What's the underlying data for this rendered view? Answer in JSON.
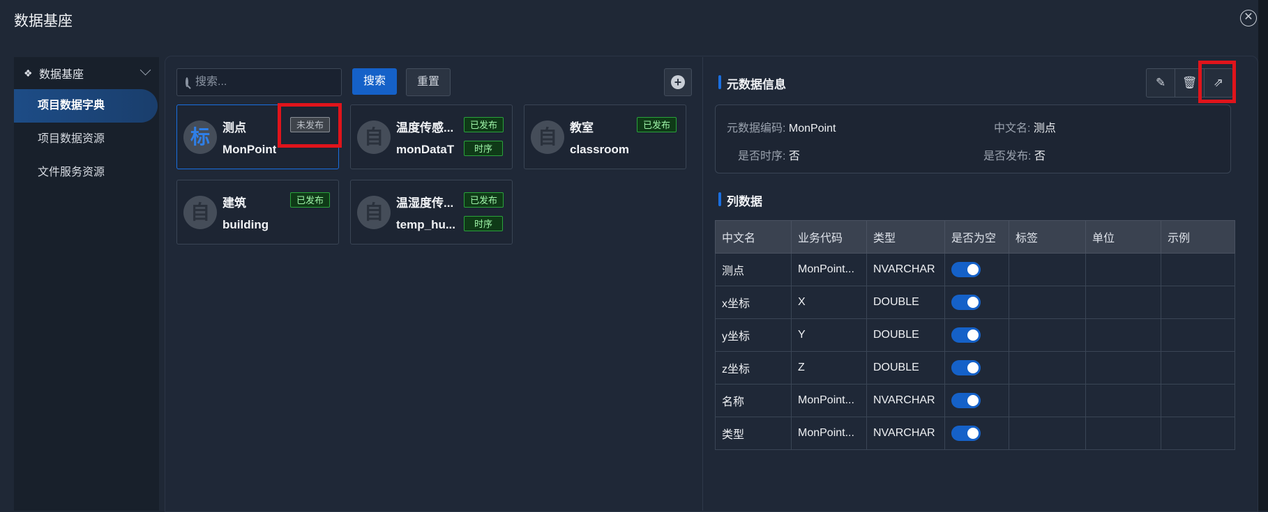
{
  "window": {
    "title": "数据基座"
  },
  "sidebar": {
    "header": "数据基座",
    "items": [
      {
        "label": "项目数据字典",
        "active": true
      },
      {
        "label": "项目数据资源"
      },
      {
        "label": "文件服务资源"
      }
    ]
  },
  "toolbar": {
    "search_placeholder": "搜索...",
    "search_label": "搜索",
    "reset_label": "重置"
  },
  "cards": [
    {
      "avatar": "标",
      "cn": "测点",
      "en": "MonPoint",
      "status": "未发布",
      "selected": true
    },
    {
      "avatar": "自",
      "cn": "温度传感...",
      "en": "monDataT",
      "status": "已发布",
      "extra": "时序"
    },
    {
      "avatar": "自",
      "cn": "教室",
      "en": "classroom",
      "status": "已发布"
    },
    {
      "avatar": "自",
      "cn": "建筑",
      "en": "building",
      "status": "已发布"
    },
    {
      "avatar": "自",
      "cn": "温湿度传...",
      "en": "temp_hu...",
      "status": "已发布",
      "extra": "时序"
    }
  ],
  "detail": {
    "meta_title": "元数据信息",
    "meta": {
      "code_label": "元数据编码:",
      "code_value": "MonPoint",
      "cname_label": "中文名:",
      "cname_value": "测点",
      "ts_label": "是否时序:",
      "ts_value": "否",
      "pub_label": "是否发布:",
      "pub_value": "否"
    },
    "cols_title": "列数据",
    "columns": [
      "中文名",
      "业务代码",
      "类型",
      "是否为空",
      "标签",
      "单位",
      "示例"
    ],
    "rows": [
      {
        "cn": "测点",
        "code": "MonPoint...",
        "type": "NVARCHAR",
        "nullable": true
      },
      {
        "cn": "x坐标",
        "code": "X",
        "type": "DOUBLE",
        "nullable": true
      },
      {
        "cn": "y坐标",
        "code": "Y",
        "type": "DOUBLE",
        "nullable": true
      },
      {
        "cn": "z坐标",
        "code": "Z",
        "type": "DOUBLE",
        "nullable": true
      },
      {
        "cn": "名称",
        "code": "MonPoint...",
        "type": "NVARCHAR",
        "nullable": true
      },
      {
        "cn": "类型",
        "code": "MonPoint...",
        "type": "NVARCHAR",
        "nullable": true
      }
    ]
  },
  "icons": {
    "close": "close-circle-icon",
    "add": "plus-circle-icon",
    "edit": "edit-list-icon",
    "delete": "trash-icon",
    "export": "external-link-icon",
    "sidebar": "dropbox-icon"
  },
  "colors": {
    "accent": "#1561c8",
    "published": "#2aa33b",
    "highlight": "#e0141b"
  }
}
